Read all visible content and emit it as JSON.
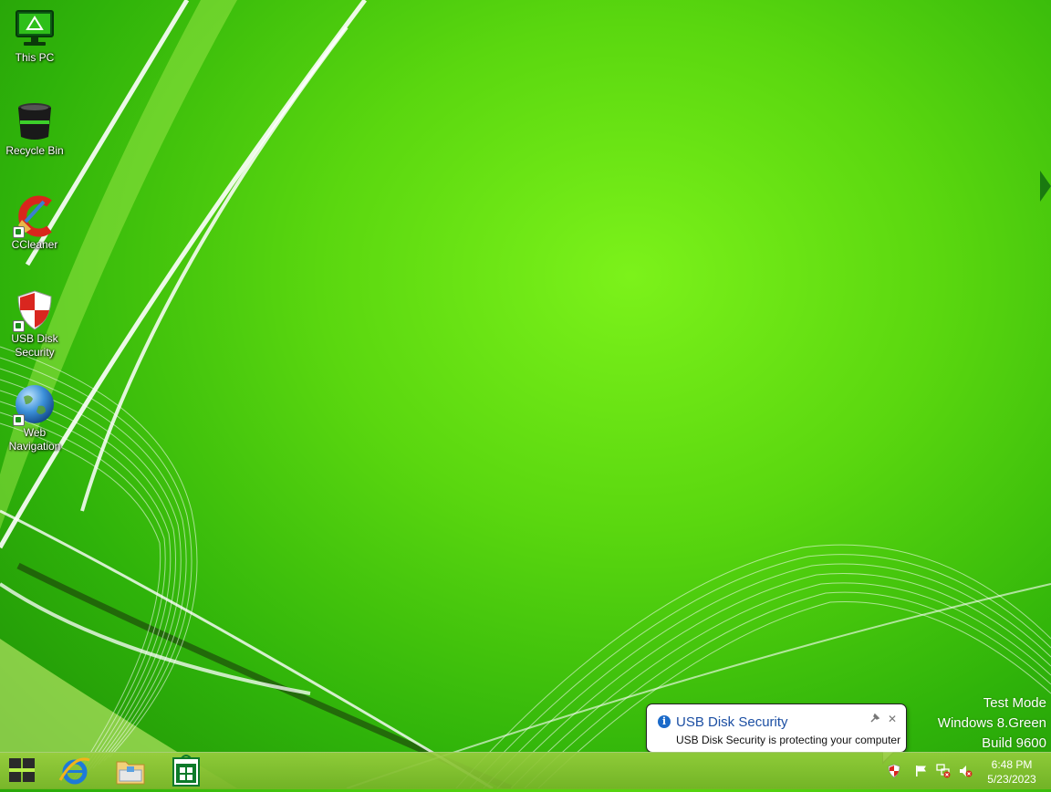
{
  "desktop": {
    "icons": [
      {
        "label": "This PC",
        "icon": "monitor-icon"
      },
      {
        "label": "Recycle Bin",
        "icon": "recycle-bin-icon"
      },
      {
        "label": "CCleaner",
        "icon": "ccleaner-icon"
      },
      {
        "label": "USB Disk\nSecurity",
        "icon": "shield-icon"
      },
      {
        "label": "Web\nNavigation",
        "icon": "globe-icon"
      }
    ]
  },
  "watermark": {
    "line1": "Test Mode",
    "line2": "Windows 8.Green",
    "line3": "Build 9600"
  },
  "notification": {
    "title": "USB Disk Security",
    "message": "USB Disk Security is protecting your computer",
    "icon": "info-icon"
  },
  "taskbar": {
    "pinned": [
      "start-icon",
      "internet-explorer-icon",
      "file-explorer-icon",
      "store-icon"
    ],
    "tray": [
      "usb-disk-security-tray-icon",
      "action-center-flag-icon",
      "network-disconnected-icon",
      "volume-muted-icon"
    ],
    "clock": {
      "time": "6:48 PM",
      "date": "5/23/2023"
    }
  },
  "colors": {
    "wallpaper": "#5ad70f",
    "taskbar": "#8fc93a",
    "notification_title": "#1c4fa3"
  }
}
